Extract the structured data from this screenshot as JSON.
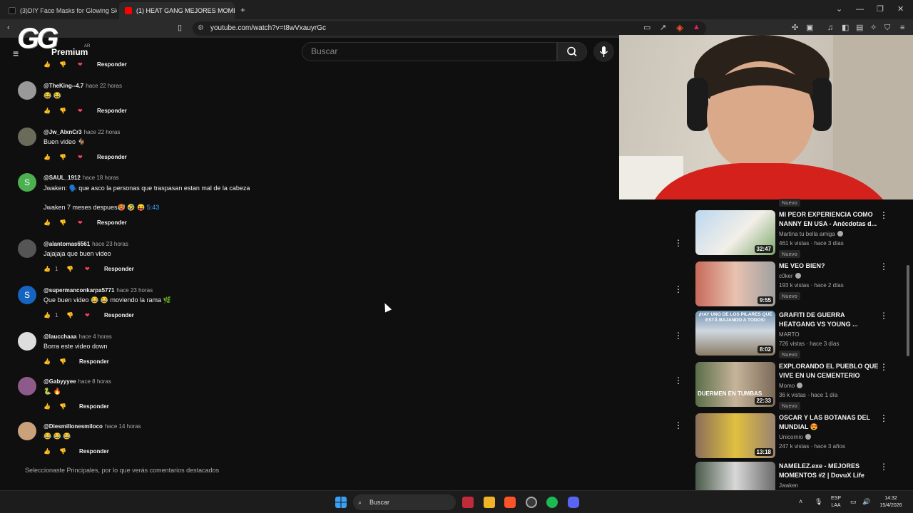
{
  "browser": {
    "tabs": [
      {
        "label": "(3)DIY Face Masks for Glowing Skin |"
      },
      {
        "label": "(1) HEAT GANG MEJORES MOME"
      }
    ],
    "new_tab": "+",
    "url": "youtube.com/watch?v=t8wVxauyrGc"
  },
  "youtube": {
    "logo_text": "GG",
    "premium": "Premium",
    "region": "AR",
    "search_placeholder": "Buscar"
  },
  "comments": [
    {
      "user": "@TheKing--4.7",
      "time": "hace 22 horas",
      "lines": [
        "😂 😂"
      ],
      "likes": "",
      "reply": "Responder",
      "heart": true
    },
    {
      "user": "@Jw_AlxnCr3",
      "time": "hace 22 horas",
      "lines": [
        "Buen video 🐐"
      ],
      "likes": "",
      "reply": "Responder",
      "heart": true
    },
    {
      "user": "@SAUL_1912",
      "time": "hace 18 horas",
      "lines": [
        "Jwaken: 🗣️ que asco la personas que traspasan estan mal de la cabeza",
        "Jwaken 7 meses despues🥵 🤣 😝"
      ],
      "timestamp": "5:43",
      "likes": "",
      "reply": "Responder",
      "heart": true,
      "avatar_letter": "S"
    },
    {
      "user": "@alantomas6561",
      "time": "hace 23 horas",
      "lines": [
        "Jajajaja que buen video"
      ],
      "likes": "1",
      "reply": "Responder",
      "heart": true
    },
    {
      "user": "@supermanconkarpa5771",
      "time": "hace 23 horas",
      "lines": [
        "Que buen video 😂 😂 moviendo la rama 🌿"
      ],
      "likes": "1",
      "reply": "Responder",
      "heart": true,
      "avatar_letter": "S"
    },
    {
      "user": "@laucchaaa",
      "time": "hace 4 horas",
      "lines": [
        "Borra este video down"
      ],
      "likes": "",
      "reply": "Responder",
      "heart": false
    },
    {
      "user": "@Gabyyyee",
      "time": "hace 8 horas",
      "lines": [
        "🐍 🔥"
      ],
      "likes": "",
      "reply": "Responder",
      "heart": false
    },
    {
      "user": "@Diesmillonesmiloco",
      "time": "hace 14 horas",
      "lines": [
        "😂 😂 😂"
      ],
      "likes": "",
      "reply": "Responder",
      "heart": false
    }
  ],
  "top_partial_reply": "Responder",
  "footer_note": "Seleccionaste Principales, por lo que verás comentarios destacados",
  "sidebar": {
    "partial_top_badge": "Nuevo",
    "videos": [
      {
        "title": "MI PEOR EXPERIENCIA COMO NANNY EN USA - Anécdotas d...",
        "channel": "Martina tu bella amiga",
        "meta": "461 k vistas · hace 3 días",
        "duration": "32:47",
        "badge": "Nuevo"
      },
      {
        "title": "ME VEO BIEN?",
        "channel": "c0ker",
        "meta": "193 k vistas · hace 2 días",
        "duration": "9:55",
        "badge": "Nuevo"
      },
      {
        "title": "GRAFITI DE GUERRA HEATGANG VS YOUNG ...",
        "channel": "MARTO",
        "meta": "726 vistas · hace 3 días",
        "duration": "8:02",
        "badge": "Nuevo",
        "thumb_text": "¡HAY UNO DE LOS PILARES QUE ESTÁ BAJANDO A TODOS!"
      },
      {
        "title": "EXPLORANDO EL PUEBLO QUE VIVE EN UN CEMENTERIO",
        "channel": "Momo",
        "meta": "36 k vistas · hace 1 día",
        "duration": "22:33",
        "badge": "Nuevo",
        "thumb_text": "DUERMEN EN TUMBAS"
      },
      {
        "title": "OSCAR Y LAS BOTANAS DEL MUNDIAL 😍",
        "channel": "Unicornio",
        "meta": "247 k vistas · hace 3 años",
        "duration": "13:18",
        "badge": ""
      },
      {
        "title": "NAMELEZ.exe - MEJORES MOMENTOS #2 | DovuX Life",
        "channel": "Jwaken",
        "meta": "",
        "duration": "",
        "badge": ""
      }
    ]
  },
  "taskbar": {
    "search": "Buscar",
    "lang_top": "ESP",
    "lang_bottom": "LAA",
    "time": "14:32",
    "date": "15/4/2026"
  },
  "colors": {
    "background": "#0f0f0f",
    "link": "#3ea6ff",
    "heart": "#ff3e5c",
    "youtube_red": "#ff0000"
  }
}
